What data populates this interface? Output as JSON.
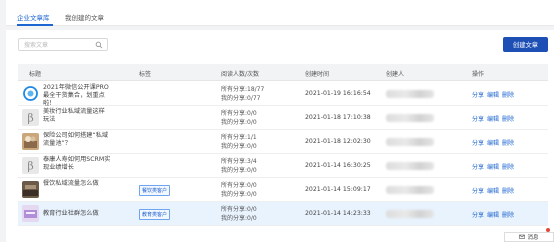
{
  "tabs": [
    {
      "label": "企业文章库"
    },
    {
      "label": "我创建的文章"
    }
  ],
  "search": {
    "placeholder": "搜索文章"
  },
  "create_button": "创建文章",
  "table": {
    "headers": [
      "标题",
      "标签",
      "阅读人数/次数",
      "创建时间",
      "创建人",
      "操作"
    ],
    "rows": [
      {
        "title": "2021年微信公开课PRO最全干货集合，划重点啦！",
        "tag": "",
        "reads_all": "所有分享:18/77",
        "reads_mine": "我的分享:0/77",
        "time": "2021-01-19 16:16:54",
        "thumb": "wechat-thumb"
      },
      {
        "title": "美妆行业私域流量这样玩法",
        "tag": "",
        "reads_all": "所有分享:0/0",
        "reads_mine": "我的分享:0/0",
        "time": "2021-01-18 17:10:38",
        "thumb": "b-logo-thumb"
      },
      {
        "title": "保险公司如何搭建“私域流量池”？",
        "tag": "",
        "reads_all": "所有分享:1/1",
        "reads_mine": "我的分享:0/0",
        "time": "2021-01-18 12:02:30",
        "thumb": "insurance-thumb"
      },
      {
        "title": "泰康人寿如何用SCRM实现业绩增长",
        "tag": "",
        "reads_all": "所有分享:3/4",
        "reads_mine": "我的分享:0/0",
        "time": "2021-01-14 16:30:25",
        "thumb": "b-logo-thumb"
      },
      {
        "title": "餐饮私域流量怎么做",
        "tag": "餐饮类客户",
        "reads_all": "所有分享:0/0",
        "reads_mine": "我的分享:0/0",
        "time": "2021-01-14 15:09:17",
        "thumb": "restaurant-thumb"
      },
      {
        "title": "教育行业社群怎么做",
        "tag": "教育类客户",
        "reads_all": "所有分享:0/0",
        "reads_mine": "我的分享:0/0",
        "time": "2021-01-14 14:23:33",
        "thumb": "education-thumb"
      }
    ],
    "ops": [
      "分享",
      "编辑",
      "删除"
    ]
  },
  "message_button": "消息",
  "colors": {
    "accent": "#1d65d1",
    "button": "#1d4fb5",
    "highlight_row": "#e9f3fd"
  }
}
